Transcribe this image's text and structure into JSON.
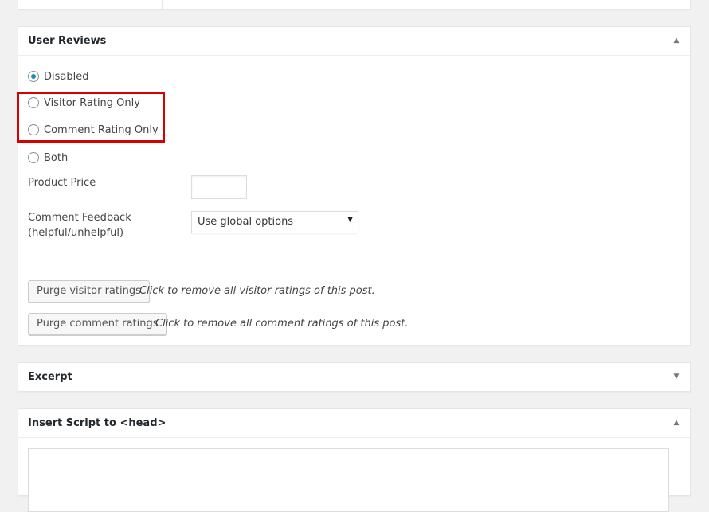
{
  "user_reviews": {
    "title": "User Reviews",
    "options": [
      "Disabled",
      "Visitor Rating Only",
      "Comment Rating Only",
      "Both"
    ],
    "selected": "Disabled",
    "product_price_label": "Product Price",
    "product_price_value": "",
    "comment_feedback_label_line1": "Comment Feedback",
    "comment_feedback_label_line2": "(helpful/unhelpful)",
    "comment_feedback_value": "Use global options",
    "purge_visitor_label": "Purge visitor ratings",
    "purge_visitor_desc": "Click to remove all visitor ratings of this post.",
    "purge_comment_label": "Purge comment ratings",
    "purge_comment_desc": "Click to remove all comment ratings of this post."
  },
  "excerpt": {
    "title": "Excerpt"
  },
  "insert_script": {
    "title": "Insert Script to <head>"
  },
  "icons": {
    "collapse": "▲",
    "expand": "▼",
    "select_arrow": "▼"
  },
  "colors": {
    "highlight": "#d90000",
    "radio_checked": "#1e8cbe"
  }
}
